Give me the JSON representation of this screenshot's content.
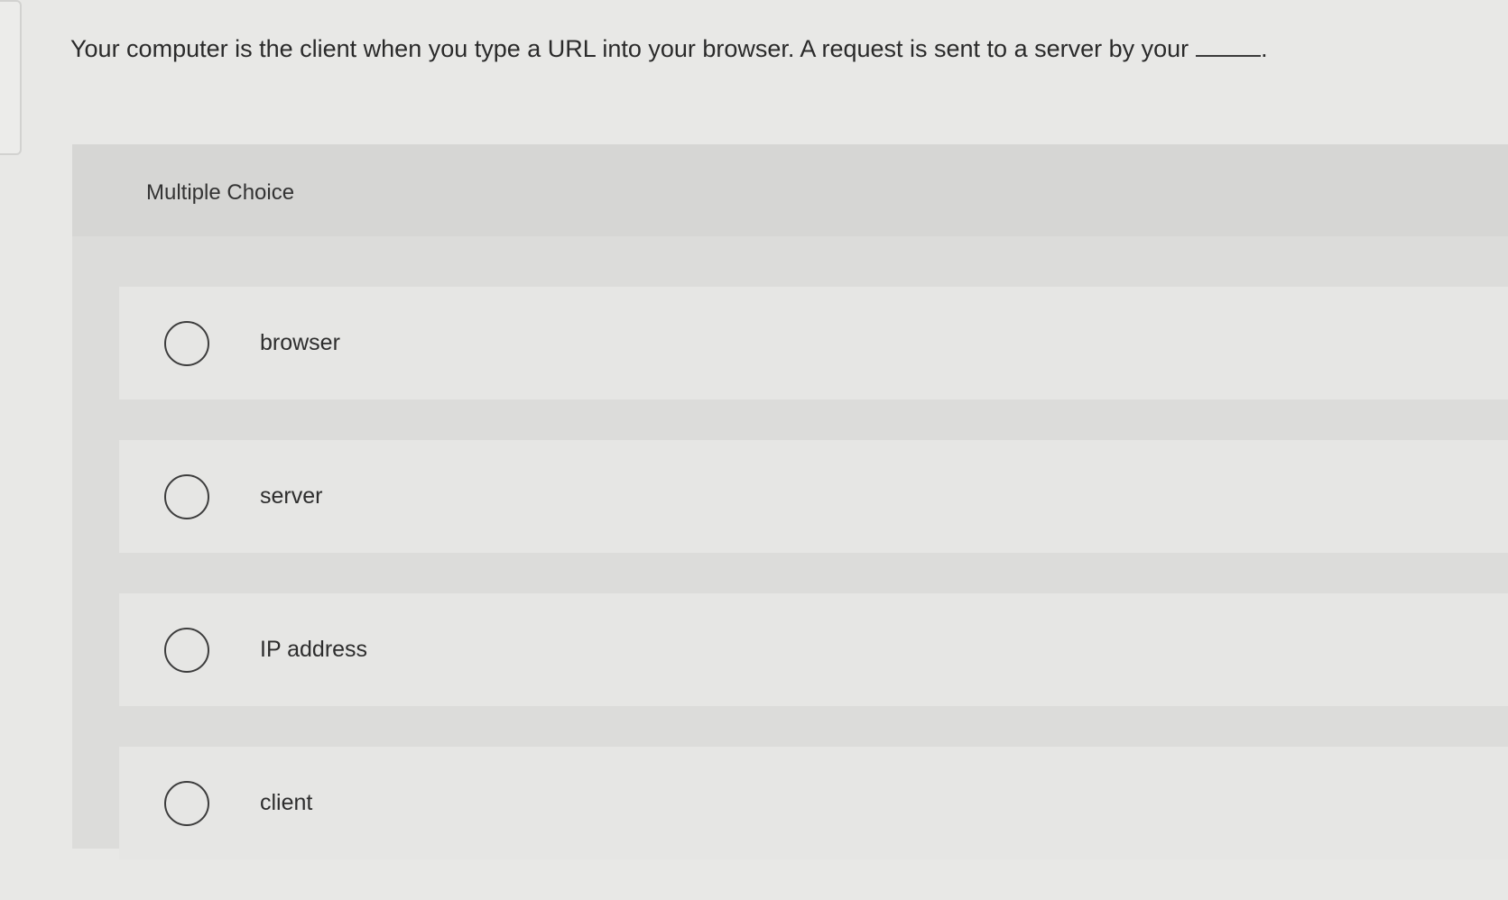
{
  "question": {
    "text": "Your computer is the client when you type a URL into your browser. A request is sent to a server by your",
    "end_punctuation": "."
  },
  "panel": {
    "title": "Multiple Choice"
  },
  "choices": [
    {
      "label": "browser"
    },
    {
      "label": "server"
    },
    {
      "label": "IP address"
    },
    {
      "label": "client"
    }
  ]
}
